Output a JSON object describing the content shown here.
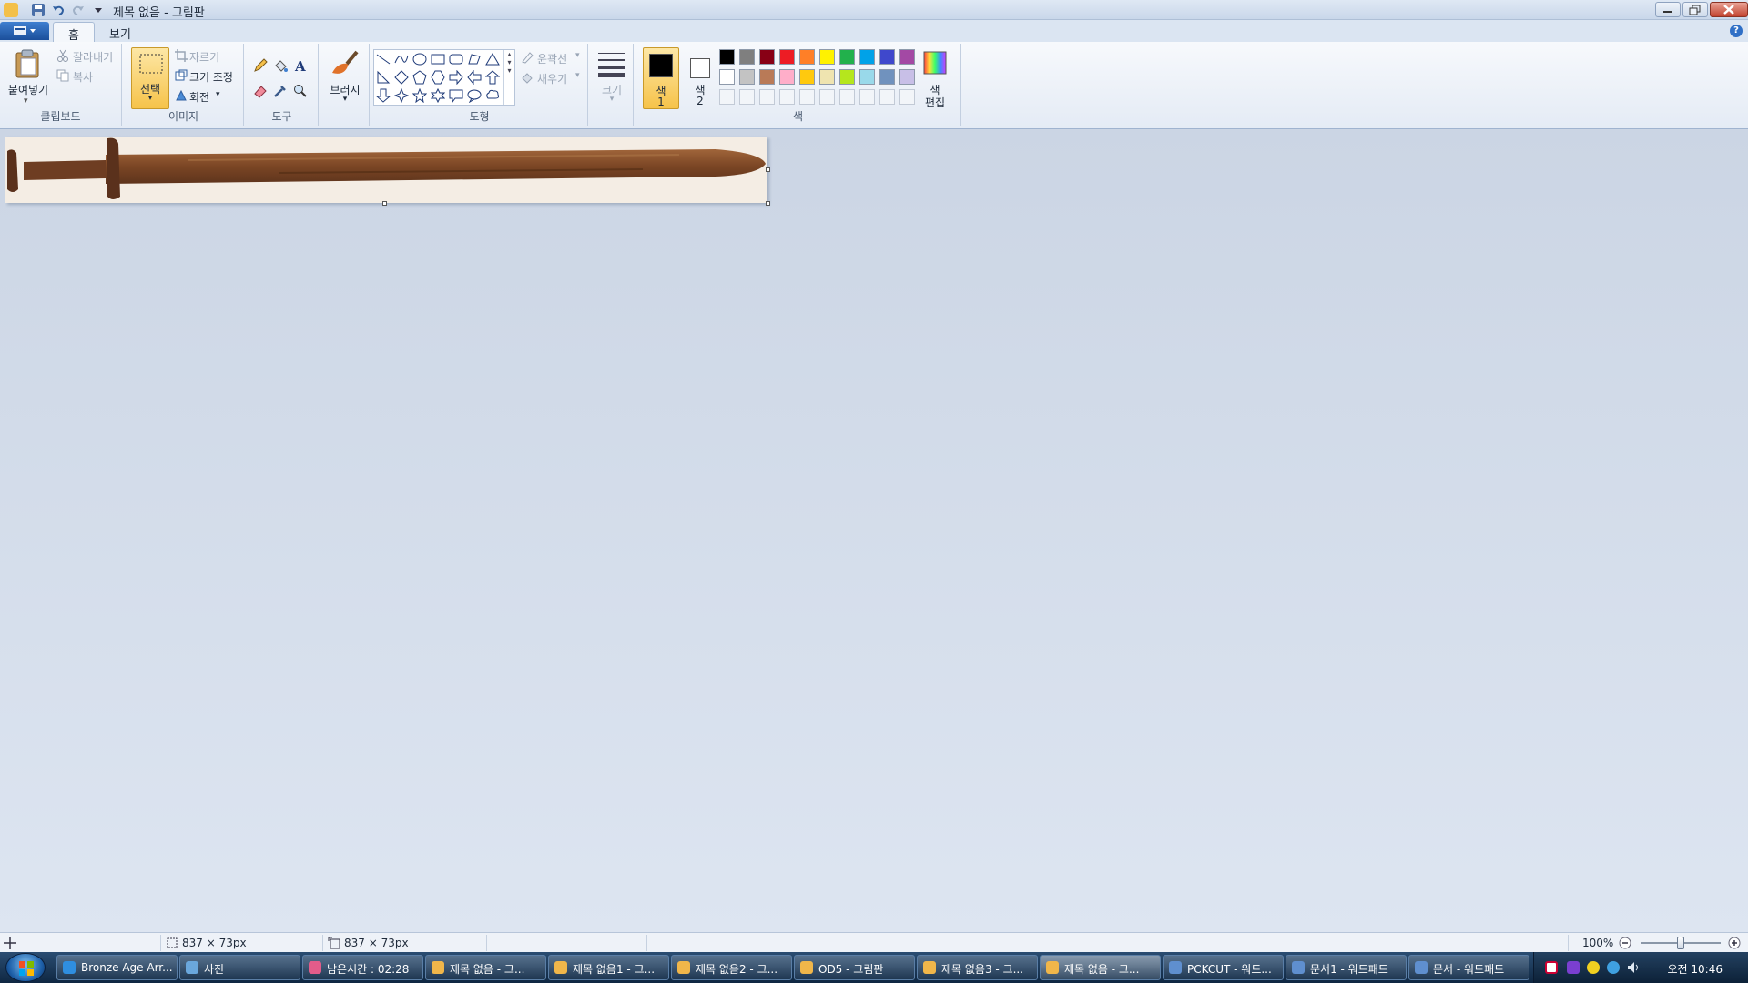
{
  "window": {
    "title": "제목 없음 - 그림판"
  },
  "tabs": {
    "home": "홈",
    "view": "보기"
  },
  "ribbon": {
    "clipboard": {
      "paste": "붙여넣기",
      "cut": "잘라내기",
      "copy": "복사",
      "group": "클립보드"
    },
    "image": {
      "select": "선택",
      "crop": "자르기",
      "resize": "크기 조정",
      "rotate": "회전",
      "group": "이미지"
    },
    "tools": {
      "group": "도구"
    },
    "brush": {
      "label": "브러시"
    },
    "shapes": {
      "outline": "윤곽선",
      "fill": "채우기",
      "group": "도형"
    },
    "size": {
      "label": "크기"
    },
    "colors": {
      "color1_label": "색",
      "color1_num": "1",
      "color2_label": "색",
      "color2_num": "2",
      "edit_label_1": "색",
      "edit_label_2": "편집",
      "group": "색",
      "color1": "#000000",
      "color2": "#ffffff",
      "row1": [
        "#000000",
        "#7f7f7f",
        "#880015",
        "#ed1c24",
        "#ff7f27",
        "#fff200",
        "#22b14c",
        "#00a2e8",
        "#3f48cc",
        "#a349a4"
      ],
      "row2": [
        "#ffffff",
        "#c3c3c3",
        "#b97a57",
        "#ffaec9",
        "#ffc90e",
        "#efe4b0",
        "#b5e61d",
        "#99d9ea",
        "#7092be",
        "#c8bfe7"
      ]
    }
  },
  "status": {
    "selection_size": "837 × 73px",
    "image_size": "837 × 73px",
    "zoom": "100%"
  },
  "taskbar": {
    "items": [
      {
        "label": "Bronze Age Arr...",
        "icon": "ie-icon",
        "color": "#2f8ee0"
      },
      {
        "label": "사진",
        "icon": "photo-icon",
        "color": "#6aa7dc"
      },
      {
        "label": "남은시간 : 02:28",
        "icon": "timer-icon",
        "color": "#e25c8a"
      },
      {
        "label": "제목 없음 - 그...",
        "icon": "paint-icon",
        "color": "#f0b64a"
      },
      {
        "label": "제목 없음1 - 그...",
        "icon": "paint-icon",
        "color": "#f0b64a"
      },
      {
        "label": "제목 없음2 - 그...",
        "icon": "paint-icon",
        "color": "#f0b64a"
      },
      {
        "label": "OD5 - 그림판",
        "icon": "paint-icon",
        "color": "#f0b64a"
      },
      {
        "label": "제목 없음3 - 그...",
        "icon": "paint-icon",
        "color": "#f0b64a"
      },
      {
        "label": "제목 없음 - 그...",
        "icon": "paint-icon",
        "color": "#f0b64a"
      },
      {
        "label": "PCKCUT - 워드...",
        "icon": "wordpad-icon",
        "color": "#5f8fcf"
      },
      {
        "label": "문서1 - 워드패드",
        "icon": "wordpad-icon",
        "color": "#5f8fcf"
      },
      {
        "label": "문서 - 워드패드",
        "icon": "wordpad-icon",
        "color": "#5f8fcf"
      }
    ],
    "clock": "오전 10:46"
  }
}
